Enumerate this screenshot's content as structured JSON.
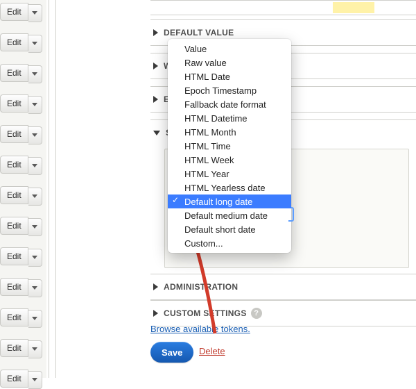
{
  "edit_label": "Edit",
  "sections": {
    "default_value": "DEFAULT VALUE",
    "w": "W",
    "e": "E",
    "s": "S",
    "administration": "ADMINISTRATION",
    "custom_settings": "CUSTOM SETTINGS"
  },
  "dropdown": {
    "options": [
      "Value",
      "Raw value",
      "HTML Date",
      "Epoch Timestamp",
      "Fallback date format",
      "HTML Datetime",
      "HTML Month",
      "HTML Time",
      "HTML Week",
      "HTML Year",
      "HTML Yearless date",
      "Default long date",
      "Default medium date",
      "Default short date",
      "Custom..."
    ],
    "selected_index": 11
  },
  "tokens_link": "Browse available tokens.",
  "save_label": "Save",
  "delete_label": "Delete",
  "help_glyph": "?"
}
